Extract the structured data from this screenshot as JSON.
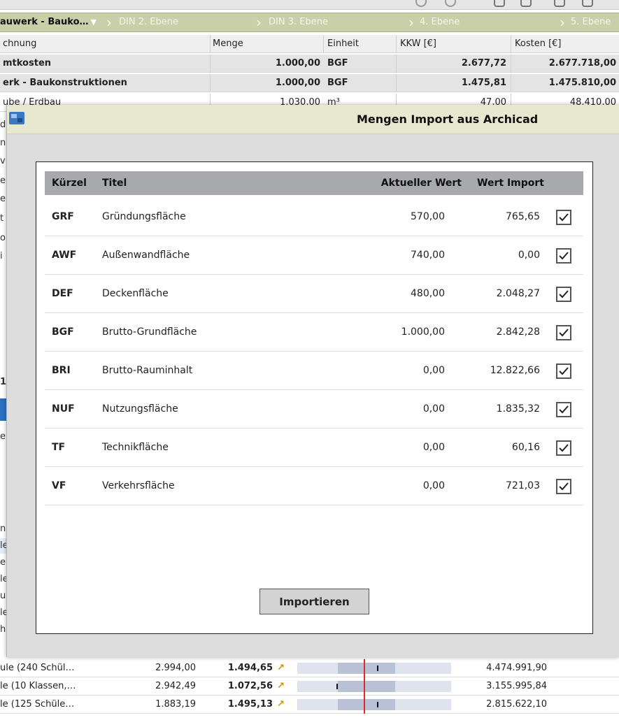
{
  "breadcrumb": {
    "items": [
      "auwerk - Bauko…",
      "DIN 2. Ebene",
      "DIN 3. Ebene",
      "4. Ebene",
      "5. Ebene"
    ]
  },
  "table": {
    "headers": [
      "chnung",
      "Menge",
      "Einheit",
      "KKW [€]",
      "Kosten [€]"
    ],
    "rows": [
      {
        "name": "mtkosten",
        "menge": "1.000,00",
        "einheit": "BGF",
        "kkw": "2.677,72",
        "kosten": "2.677.718,00"
      },
      {
        "name": "erk - Baukonstruktionen",
        "menge": "1.000,00",
        "einheit": "BGF",
        "kkw": "1.475,81",
        "kosten": "1.475.810,00"
      },
      {
        "name": "ube / Erdbau",
        "menge": "1.030,00",
        "einheit": "m³",
        "kkw": "47,00",
        "kosten": "48.410,00"
      }
    ]
  },
  "left_fragments": [
    "d",
    "n",
    "v",
    "e",
    "e",
    "t",
    "o",
    "i",
    "1",
    "en",
    "n",
    "le",
    "e",
    "le",
    "u",
    "le",
    "h"
  ],
  "bottom_rows": [
    {
      "name": "ule (240 Schül…",
      "a": "2.994,00",
      "b": "1.494,65",
      "c": "4.474.991,90"
    },
    {
      "name": "le (10 Klassen,…",
      "a": "2.942,49",
      "b": "1.072,56",
      "c": "3.155.995,84"
    },
    {
      "name": "le (125 Schüle…",
      "a": "1.883,19",
      "b": "1.495,13",
      "c": "2.815.622,10"
    }
  ],
  "dialog": {
    "title": "Mengen Import aus Archicad",
    "headers": {
      "code": "Kürzel",
      "title": "Titel",
      "current": "Aktueller Wert",
      "import": "Wert Import"
    },
    "rows": [
      {
        "code": "GRF",
        "title": "Gründungsfläche",
        "current": "570,00",
        "import": "765,65",
        "checked": true
      },
      {
        "code": "AWF",
        "title": "Außenwandfläche",
        "current": "740,00",
        "import": "0,00",
        "checked": true
      },
      {
        "code": "DEF",
        "title": "Deckenfläche",
        "current": "480,00",
        "import": "2.048,27",
        "checked": true
      },
      {
        "code": "BGF",
        "title": "Brutto-Grundfläche",
        "current": "1.000,00",
        "import": "2.842,28",
        "checked": true
      },
      {
        "code": "BRI",
        "title": "Brutto-Rauminhalt",
        "current": "0,00",
        "import": "12.822,66",
        "checked": true
      },
      {
        "code": "NUF",
        "title": "Nutzungsfläche",
        "current": "0,00",
        "import": "1.835,32",
        "checked": true
      },
      {
        "code": "TF",
        "title": "Technikfläche",
        "current": "0,00",
        "import": "60,16",
        "checked": true
      },
      {
        "code": "VF",
        "title": "Verkehrsfläche",
        "current": "0,00",
        "import": "721,03",
        "checked": true
      }
    ],
    "button_label": "Importieren"
  },
  "colors": {
    "breadcrumb_bg": "#c9cfa9",
    "dialog_title_bg": "#e7e8cf",
    "grid_header_bg": "#a7a9ac",
    "gauge_marker": "#e02a2a"
  }
}
